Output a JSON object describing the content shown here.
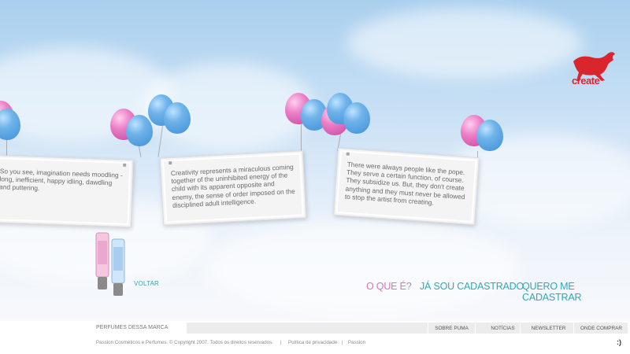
{
  "cards": [
    {
      "text": "So you see, imagination needs moodling - long, inefficient, happy idling, dawdling and puttering."
    },
    {
      "text": "Creativity represents a miraculous coming together of the uninhibited energy of the child with its apparent opposite and enemy, the sense of order imposed on the disciplined adult intelligence."
    },
    {
      "text": "There were always people like the pope. They serve a certain function, of course. They subsidize us. But, they don't create anything and they must never be allowed to stop the artist from creating."
    }
  ],
  "logo": {
    "text": "create",
    "color": "#d9262c"
  },
  "voltar_label": "VOLTAR",
  "nav": {
    "o_que_e": "O QUE É?",
    "ja_sou": "JÁ SOU CADASTRADO",
    "quero": "QUERO ME CADASTRAR"
  },
  "footer": {
    "brand_tab": "PERFUMES DESSA MARCA",
    "links": [
      "SOBRE PUMA",
      "NOTÍCIAS",
      "NEWSLETTER",
      "ONDE COMPRAR"
    ],
    "copyright": "Passion Cosméticos e Perfumes. © Copyright 2007. Todos os direitos reservados.",
    "privacy": "Política de privacidade",
    "passion": "Passion",
    "smiley": ":)"
  },
  "colors": {
    "pink_link": "#d975b7",
    "teal_link": "#2fa8b8",
    "balloon_blue": "#6fb3ea",
    "balloon_pink": "#ea7ec6"
  },
  "icons": [
    "puma-cat-logo",
    "balloon",
    "perfume-tube"
  ]
}
